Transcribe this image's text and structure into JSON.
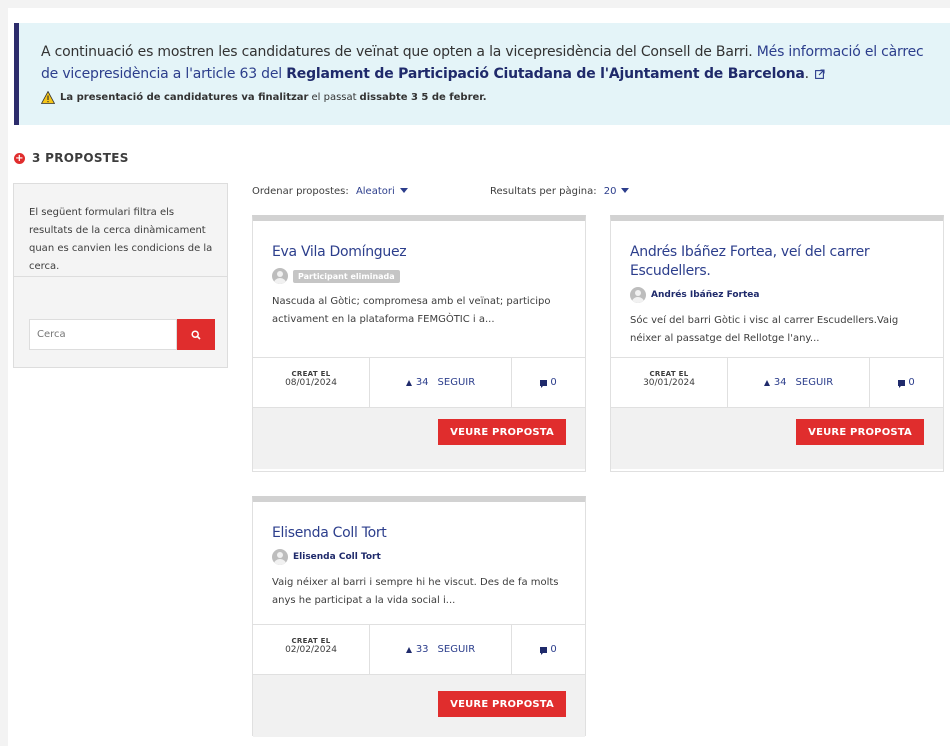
{
  "callout": {
    "intro": "A continuació es mostren les candidatures de veïnat que opten a la vicepresidència del Consell de Barri.",
    "link": "Més informació el càrrec de vicepresidència a l'article 63 del",
    "link_strong": "Reglament de Participació Ciutadana de l'Ajuntament de Barcelona",
    "period": ".",
    "warning_strong": "La presentació de candidatures va finalitzar",
    "warning_mid": "el passat",
    "warning_date": "dissabte 3 5 de febrer."
  },
  "results": {
    "count_label": "3 PROPOSTES"
  },
  "filter": {
    "description": "El següent formulari filtra els resultats de la cerca dinàmicament quan es canvien les condicions de la cerca.",
    "search_placeholder": "Cerca"
  },
  "sorting": {
    "order_label": "Ordenar propostes:",
    "order_value": "Aleatori",
    "per_page_label": "Resultats per pàgina:",
    "per_page_value": "20"
  },
  "cards": [
    {
      "title": "Eva Vila Domínguez",
      "author": "Participant eliminada",
      "description": "Nascuda al Gòtic; compromesa amb el veïnat; participo activament en la plataforma FEMGÒTIC i a...",
      "created_label": "CREAT EL",
      "created_date": "08/01/2024",
      "votes": "34",
      "follow_label": "SEGUIR",
      "comments": "0",
      "button_label": "VEURE PROPOSTA"
    },
    {
      "title": "Andrés Ibáñez Fortea, veí del carrer Escudellers.",
      "author": "Andrés Ibáñez Fortea",
      "description": "Sóc veí del barri Gòtic i visc al carrer Escudellers.Vaig néixer al passatge del Rellotge l'any...",
      "created_label": "CREAT EL",
      "created_date": "30/01/2024",
      "votes": "34",
      "follow_label": "SEGUIR",
      "comments": "0",
      "button_label": "VEURE PROPOSTA"
    },
    {
      "title": "Elisenda Coll Tort",
      "author": "Elisenda Coll Tort",
      "description": "Vaig néixer al barri i sempre hi he viscut. Des de fa molts anys he participat a la vida social i...",
      "created_label": "CREAT EL",
      "created_date": "02/02/2024",
      "votes": "33",
      "follow_label": "SEGUIR",
      "comments": "0",
      "button_label": "VEURE PROPOSTA"
    }
  ]
}
